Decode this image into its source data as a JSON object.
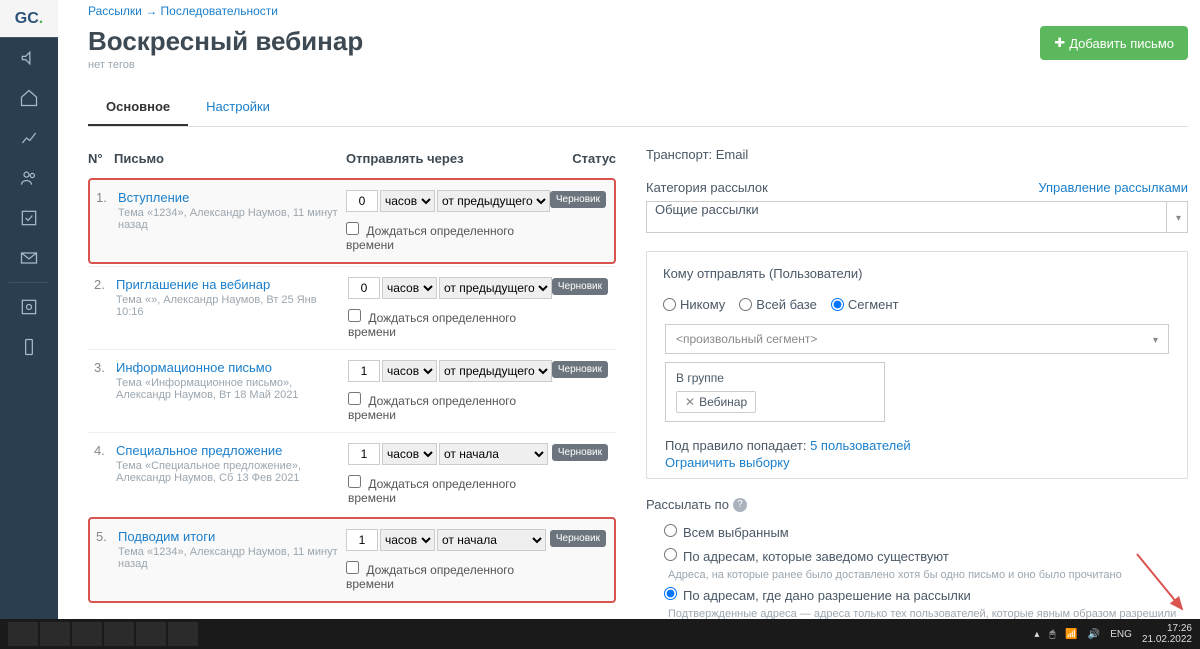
{
  "breadcrumb": {
    "a": "Рассылки",
    "b": "Последовательности"
  },
  "title": "Воскресный вебинар",
  "notags": "нет тегов",
  "addLetter": "Добавить письмо",
  "tabs": {
    "main": "Основное",
    "settings": "Настройки"
  },
  "cols": {
    "n": "N°",
    "letter": "Письмо",
    "send": "Отправлять через",
    "status": "Статус"
  },
  "unit": "часов",
  "relPrev": "от предыдущего",
  "relStart": "от начала",
  "wait": "Дождаться определенного времени",
  "draft": "Черновик",
  "rows": [
    {
      "n": "1.",
      "title": "Вступление",
      "sub": "Тема «1234», Александр Наумов, 11 минут назад",
      "val": "0",
      "rel": "от предыдущего",
      "hl": true
    },
    {
      "n": "2.",
      "title": "Приглашение на вебинар",
      "sub": "Тема «», Александр Наумов, Вт 25 Янв 10:16",
      "val": "0",
      "rel": "от предыдущего",
      "hl": false
    },
    {
      "n": "3.",
      "title": "Информационное письмо",
      "sub": "Тема «Информационное письмо», Александр Наумов, Вт 18 Май 2021",
      "val": "1",
      "rel": "от предыдущего",
      "hl": false
    },
    {
      "n": "4.",
      "title": "Специальное предложение",
      "sub": "Тема «Специальное предложение», Александр Наумов, Сб 13 Фев 2021",
      "val": "1",
      "rel": "от начала",
      "hl": false
    },
    {
      "n": "5.",
      "title": "Подводим итоги",
      "sub": "Тема «1234», Александр Наумов, 11 минут назад",
      "val": "1",
      "rel": "от начала",
      "hl": true
    }
  ],
  "transport": {
    "label": "Транспорт:",
    "value": "Email"
  },
  "category": {
    "label": "Категория рассылок",
    "manage": "Управление рассылками",
    "value": "Общие рассылки"
  },
  "recipients": {
    "label": "Кому отправлять (Пользователи)",
    "none": "Никому",
    "all": "Всей базе",
    "seg": "Сегмент",
    "segph": "<произвольный сегмент>",
    "inGroup": "В группе",
    "groupTag": "Вебинар",
    "rule": "Под правило попадает:",
    "ruleCount": "5 пользователей",
    "limit": "Ограничить выборку"
  },
  "sendby": {
    "label": "Рассылать по",
    "opt1": "Всем выбранным",
    "opt2": "По адресам, которые заведомо существуют",
    "opt2hint": "Адреса, на которые ранее было доставлено хотя бы одно письмо и оно было прочитано",
    "opt3": "По адресам, где дано разрешение на рассылки",
    "opt3hint": "Подтвержденные адреса — адреса только тех пользователей, которые явным образом разрешили отправку писем с помощью Double-opt-In"
  },
  "taskbar": {
    "lang": "ENG",
    "time": "17:26",
    "date": "21.02.2022"
  }
}
